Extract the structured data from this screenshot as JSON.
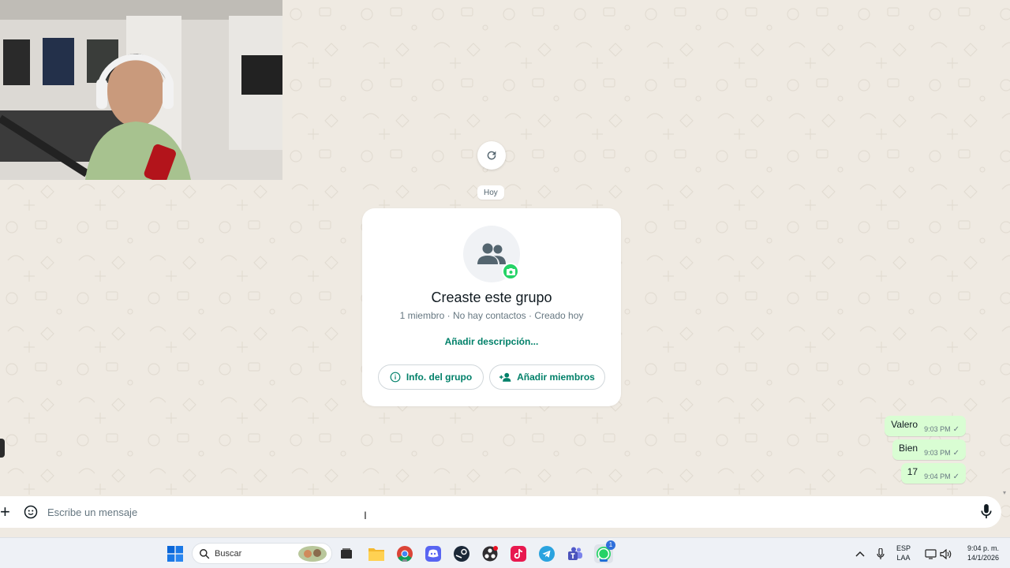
{
  "chat": {
    "date_label": "Hoy",
    "group_card": {
      "title": "Creaste este grupo",
      "subtitle": "1 miembro · No hay contactos · Creado hoy",
      "add_description": "Añadir descripción...",
      "info_button": "Info. del grupo",
      "add_members_button": "Añadir miembros"
    },
    "messages": [
      {
        "text": "Valero",
        "time": "9:03 PM",
        "status": "sent"
      },
      {
        "text": "Bien",
        "time": "9:03 PM",
        "status": "sent"
      },
      {
        "text": "17",
        "time": "9:04 PM",
        "status": "sent"
      }
    ]
  },
  "composer": {
    "placeholder": "Escribe un mensaje"
  },
  "taskbar": {
    "search_label": "Buscar",
    "language": "ESP",
    "layout": "LAA",
    "time": "9:04 p. m.",
    "date": "14/1/2026",
    "whatsapp_badge": "1"
  },
  "colors": {
    "accent": "#008069",
    "bubble_out": "#d9fdd3",
    "chat_bg": "#efeae2",
    "badge_green": "#25d366"
  },
  "icons": {
    "refresh": "refresh-icon",
    "group": "group-icon",
    "camera": "camera-icon",
    "info": "info-icon",
    "add_person": "add-person-icon",
    "check": "check-icon",
    "plus": "plus-icon",
    "emoji": "sticker-icon",
    "mic": "mic-icon"
  }
}
